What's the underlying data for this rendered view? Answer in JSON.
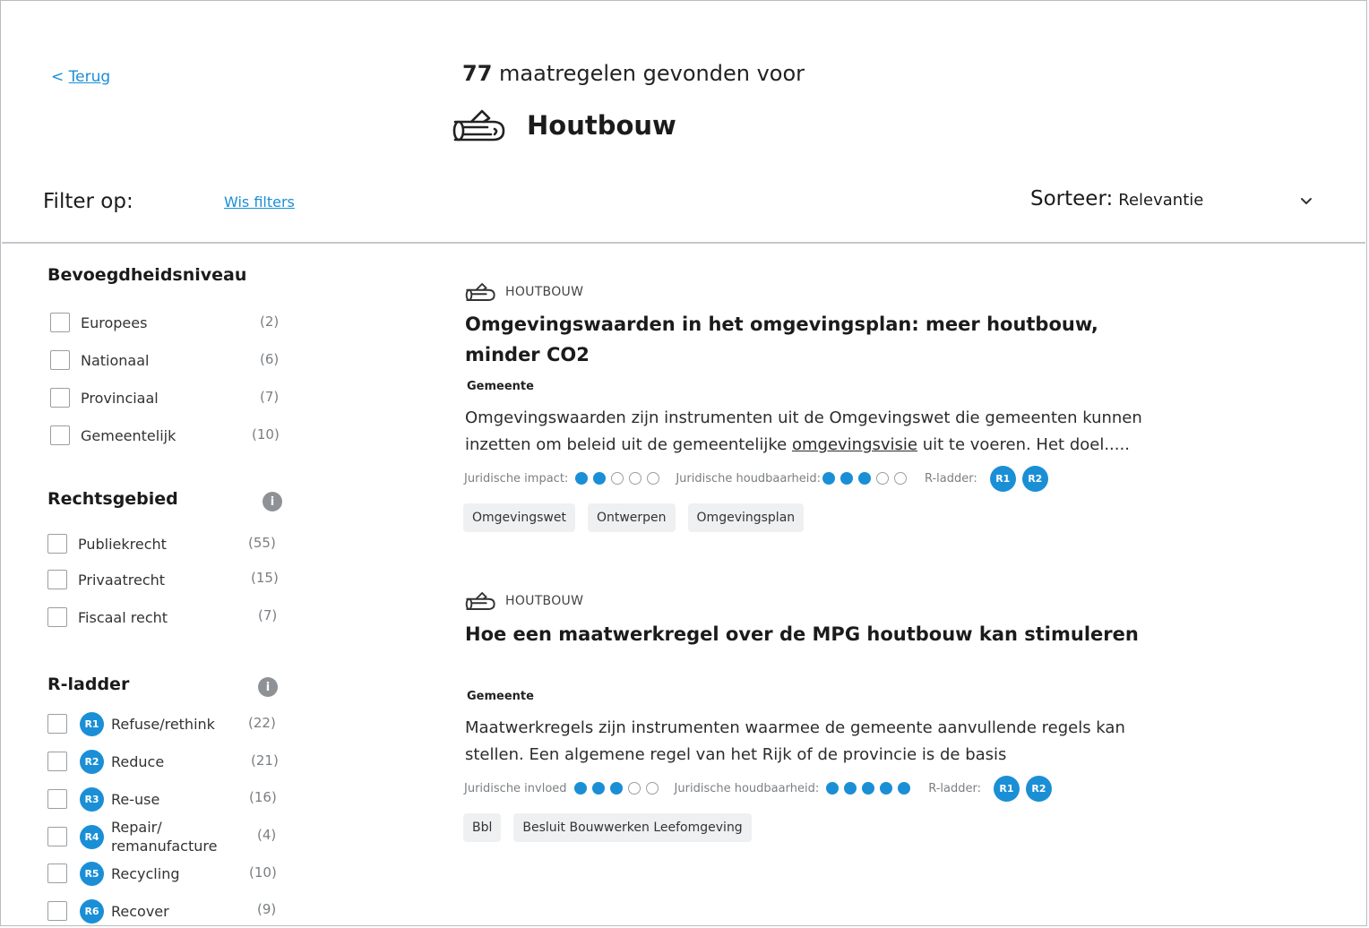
{
  "header": {
    "back_arrow": "<",
    "back_label": "Terug",
    "result_count": "77",
    "result_suffix": "maatregelen gevonden voor",
    "category_icon": "wood-log-icon",
    "category_title": "Houtbouw"
  },
  "toolbar": {
    "filter_label": "Filter op:",
    "clear_filters": "Wis filters",
    "sort_label": "Sorteer:",
    "sort_value": "Relevantie"
  },
  "filters": {
    "bevoegdheid": {
      "title": "Bevoegdheidsniveau",
      "items": [
        {
          "label": "Europees",
          "count": "(2)"
        },
        {
          "label": "Nationaal",
          "count": "(6)"
        },
        {
          "label": "Provinciaal",
          "count": "(7)"
        },
        {
          "label": "Gemeentelijk",
          "count": "(10)"
        }
      ]
    },
    "rechtsgebied": {
      "title": "Rechtsgebied",
      "info": "i",
      "items": [
        {
          "label": "Publiekrecht",
          "count": "(55)"
        },
        {
          "label": "Privaatrecht",
          "count": "(15)"
        },
        {
          "label": "Fiscaal recht",
          "count": "(7)"
        }
      ]
    },
    "rladder": {
      "title": "R-ladder",
      "info": "i",
      "items": [
        {
          "badge": "R1",
          "label": "Refuse/rethink",
          "count": "(22)"
        },
        {
          "badge": "R2",
          "label": "Reduce",
          "count": "(21)"
        },
        {
          "badge": "R3",
          "label": "Re-use",
          "count": "(16)"
        },
        {
          "badge": "R4",
          "label": "Repair/",
          "label2": "remanufacture",
          "count": "(4)"
        },
        {
          "badge": "R5",
          "label": "Recycling",
          "count": "(10)"
        },
        {
          "badge": "R6",
          "label": "Recover",
          "count": "(9)"
        }
      ]
    }
  },
  "results": [
    {
      "category": "HOUTBOUW",
      "title_line1": "Omgevingswaarden in het omgevingsplan: meer houtbouw,",
      "title_line2": "minder CO2",
      "org": "Gemeente",
      "desc_line1": "Omgevingswaarden zijn instrumenten uit de Omgevingswet die gemeenten kunnen",
      "desc_line2_a": "inzetten om beleid uit de gemeentelijke ",
      "desc_line2_u": "omgevingsvisie",
      "desc_line2_b": " uit te voeren. Het doel.....",
      "meta1_label": "Juridische impact:",
      "meta1_score": 2,
      "meta2_label": "Juridische houdbaarheid:",
      "meta2_score": 3,
      "ladder_label": "R-ladder:",
      "badges": [
        "R1",
        "R2"
      ],
      "tags": [
        "Omgevingswet",
        "Ontwerpen",
        "Omgevingsplan"
      ]
    },
    {
      "category": "HOUTBOUW",
      "title_line1": "Hoe een maatwerkregel over de MPG houtbouw kan stimuleren",
      "org": "Gemeente",
      "desc_line1": "Maatwerkregels zijn instrumenten waarmee de gemeente aanvullende regels kan",
      "desc_line2": "stellen. Een algemene regel van het Rijk of de provincie is de basis",
      "meta1_label": "Juridische invloed",
      "meta1_score": 3,
      "meta2_label": "Juridische houdbaarheid:",
      "meta2_score": 5,
      "ladder_label": "R-ladder:",
      "badges": [
        "R1",
        "R2"
      ],
      "tags": [
        "Bbl",
        "Besluit Bouwwerken Leefomgeving"
      ]
    }
  ],
  "colors": {
    "accent": "#1a8fd6",
    "tag_bg": "#eef0f2",
    "muted": "#7b7f83"
  }
}
